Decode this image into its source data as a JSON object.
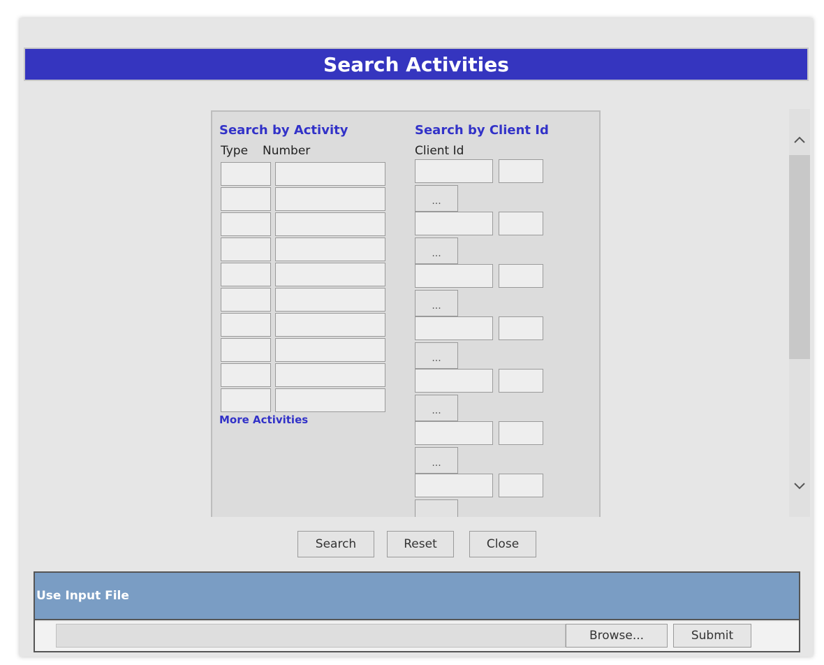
{
  "header": {
    "title": "Search Activities"
  },
  "activity": {
    "title": "Search by Activity",
    "type_label": "Type",
    "number_label": "Number",
    "more_link": "More Activities"
  },
  "client": {
    "title": "Search by Client Id",
    "id_label": "Client Id",
    "lookup_label": "..."
  },
  "buttons": {
    "search": "Search",
    "reset": "Reset",
    "close": "Close"
  },
  "scrollbar": {
    "up_icon": "chevron-up-icon",
    "down_icon": "chevron-down-icon"
  },
  "input_file": {
    "title": "Use Input File",
    "browse": "Browse...",
    "submit": "Submit"
  },
  "colors": {
    "title_bar": "#3535bf",
    "section_title": "#3232c8",
    "input_file_header": "#7a9dc4"
  }
}
